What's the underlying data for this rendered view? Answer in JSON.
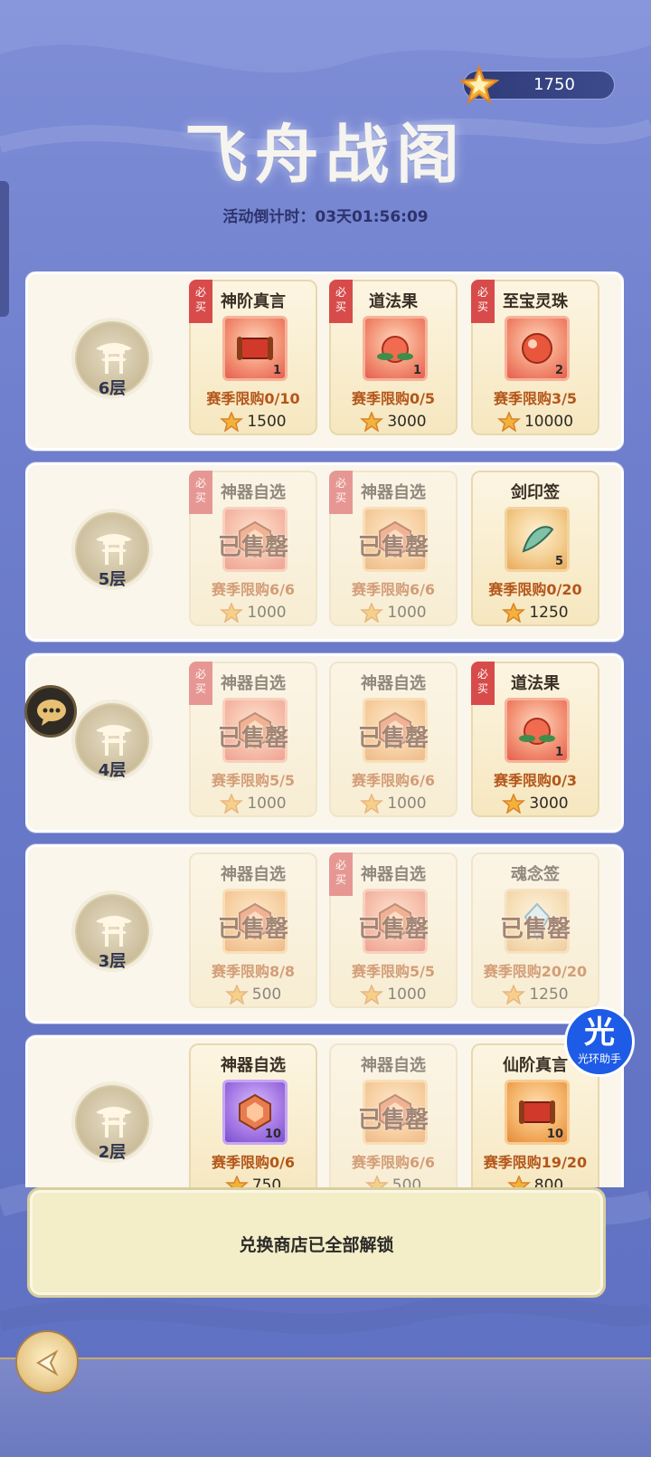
{
  "header": {
    "currency_amount": "1750",
    "title": "飞舟战阁",
    "countdown_label": "活动倒计时：03天01:56:09"
  },
  "labels": {
    "must_buy": "必\n买",
    "sold_out": "已售罄"
  },
  "floors": [
    {
      "label": "6层",
      "items": [
        {
          "name": "神阶真言",
          "must_buy": true,
          "sold": false,
          "icon": "scroll-icon",
          "qty": "1",
          "limit": "赛季限购0/10",
          "price": "1500",
          "tone": "red"
        },
        {
          "name": "道法果",
          "must_buy": true,
          "sold": false,
          "icon": "peach-icon",
          "qty": "1",
          "limit": "赛季限购0/5",
          "price": "3000",
          "tone": "red"
        },
        {
          "name": "至宝灵珠",
          "must_buy": true,
          "sold": false,
          "icon": "orb-icon",
          "qty": "2",
          "limit": "赛季限购3/5",
          "price": "10000",
          "tone": "red"
        }
      ]
    },
    {
      "label": "5层",
      "items": [
        {
          "name": "神器自选",
          "must_buy": true,
          "sold": true,
          "icon": "chest-icon",
          "qty": "",
          "limit": "赛季限购6/6",
          "price": "1000",
          "tone": "red"
        },
        {
          "name": "神器自选",
          "must_buy": true,
          "sold": true,
          "icon": "chest-icon",
          "qty": "",
          "limit": "赛季限购6/6",
          "price": "1000",
          "tone": "orange"
        },
        {
          "name": "剑印签",
          "must_buy": false,
          "sold": false,
          "icon": "jade-token-icon",
          "qty": "5",
          "limit": "赛季限购0/20",
          "price": "1250",
          "tone": "teal"
        }
      ]
    },
    {
      "label": "4层",
      "items": [
        {
          "name": "神器自选",
          "must_buy": true,
          "sold": true,
          "icon": "chest-icon",
          "qty": "",
          "limit": "赛季限购5/5",
          "price": "1000",
          "tone": "red"
        },
        {
          "name": "神器自选",
          "must_buy": false,
          "sold": true,
          "icon": "chest-icon",
          "qty": "",
          "limit": "赛季限购6/6",
          "price": "1000",
          "tone": "orange"
        },
        {
          "name": "道法果",
          "must_buy": true,
          "sold": false,
          "icon": "peach-icon",
          "qty": "1",
          "limit": "赛季限购0/3",
          "price": "3000",
          "tone": "red"
        }
      ]
    },
    {
      "label": "3层",
      "items": [
        {
          "name": "神器自选",
          "must_buy": false,
          "sold": true,
          "icon": "chest-icon",
          "qty": "",
          "limit": "赛季限购8/8",
          "price": "500",
          "tone": "orange"
        },
        {
          "name": "神器自选",
          "must_buy": true,
          "sold": true,
          "icon": "chest-icon",
          "qty": "",
          "limit": "赛季限购5/5",
          "price": "1000",
          "tone": "red"
        },
        {
          "name": "魂念签",
          "must_buy": false,
          "sold": true,
          "icon": "crystal-token-icon",
          "qty": "",
          "limit": "赛季限购20/20",
          "price": "1250",
          "tone": "teal"
        }
      ]
    },
    {
      "label": "2层",
      "items": [
        {
          "name": "神器自选",
          "must_buy": false,
          "sold": false,
          "icon": "chest-icon",
          "qty": "10",
          "limit": "赛季限购0/6",
          "price": "750",
          "tone": "purple"
        },
        {
          "name": "神器自选",
          "must_buy": false,
          "sold": true,
          "icon": "chest-icon",
          "qty": "",
          "limit": "赛季限购6/6",
          "price": "500",
          "tone": "orange"
        },
        {
          "name": "仙阶真言",
          "must_buy": false,
          "sold": false,
          "icon": "scroll-icon",
          "qty": "10",
          "limit": "赛季限购19/20",
          "price": "800",
          "tone": "orange"
        }
      ]
    }
  ],
  "footer": {
    "unlock_message": "兑换商店已全部解锁"
  },
  "assistant": {
    "glyph": "光",
    "label": "光环助手"
  },
  "colors": {
    "background": "#6f7fcd",
    "card": "#f6e7bf",
    "must_buy": "#d84b4b",
    "limit_text": "#b4561a"
  }
}
